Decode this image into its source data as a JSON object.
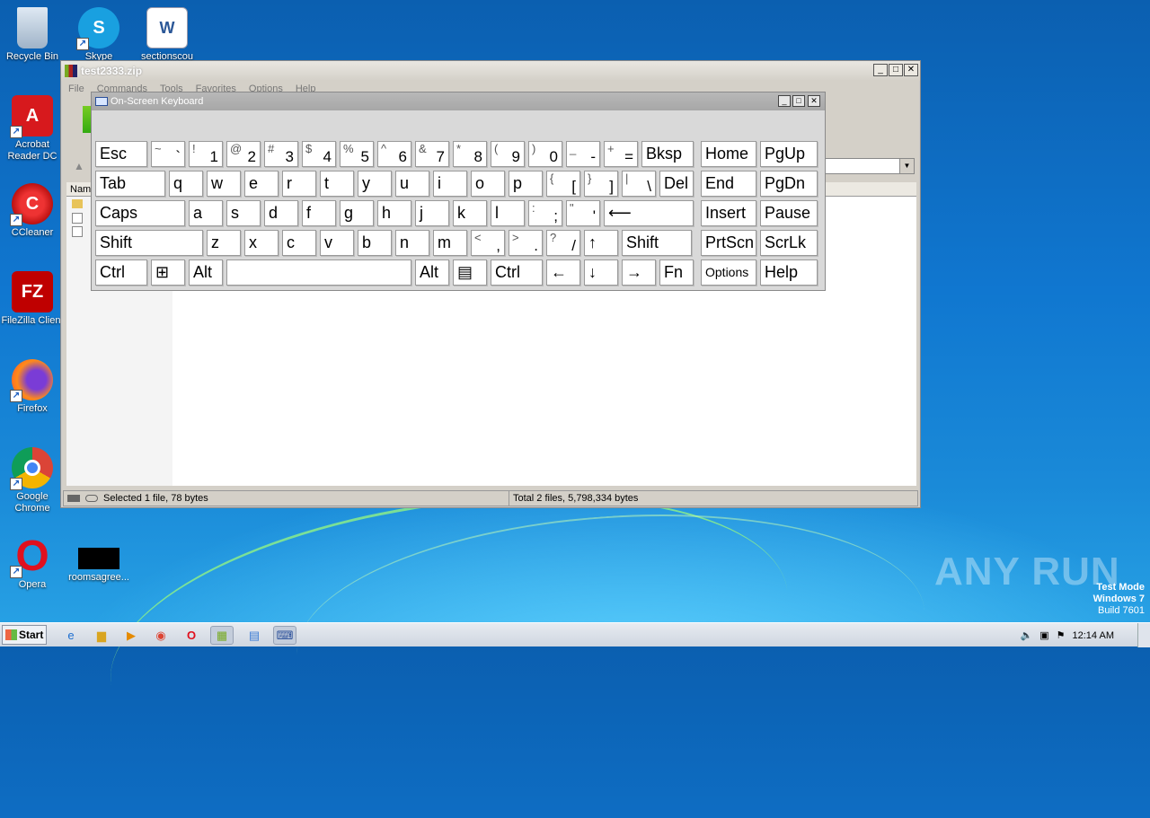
{
  "desktop": {
    "icons": [
      {
        "label": "Recycle Bin"
      },
      {
        "label": "Skype"
      },
      {
        "label": "sectionscou"
      },
      {
        "label": "Acrobat Reader DC"
      },
      {
        "label": "CCleaner"
      },
      {
        "label": "FileZilla Client"
      },
      {
        "label": "Firefox"
      },
      {
        "label": "Google Chrome"
      },
      {
        "label": "Opera"
      },
      {
        "label": "roomsagree..."
      }
    ]
  },
  "archive_window": {
    "title": "test2333.zip",
    "menu": [
      "File",
      "Commands",
      "Tools",
      "Favorites",
      "Options",
      "Help"
    ],
    "column_name": "Name",
    "status_left": "Selected 1 file, 78 bytes",
    "status_right": "Total 2 files, 5,798,334 bytes"
  },
  "osk": {
    "title": "On-Screen Keyboard",
    "rows": [
      [
        {
          "m": "Esc"
        },
        {
          "t": "~",
          "b": "`"
        },
        {
          "t": "!",
          "b": "1"
        },
        {
          "t": "@",
          "b": "2"
        },
        {
          "t": "#",
          "b": "3"
        },
        {
          "t": "$",
          "b": "4"
        },
        {
          "t": "%",
          "b": "5"
        },
        {
          "t": "^",
          "b": "6"
        },
        {
          "t": "&",
          "b": "7"
        },
        {
          "t": "*",
          "b": "8"
        },
        {
          "t": "(",
          "b": "9"
        },
        {
          "t": ")",
          "b": "0"
        },
        {
          "t": "_",
          "b": "-"
        },
        {
          "t": "+",
          "b": "="
        },
        {
          "m": "Bksp"
        },
        {
          "m": "Home"
        },
        {
          "m": "PgUp"
        }
      ],
      [
        {
          "m": "Tab"
        },
        {
          "m": "q"
        },
        {
          "m": "w"
        },
        {
          "m": "e"
        },
        {
          "m": "r"
        },
        {
          "m": "t"
        },
        {
          "m": "y"
        },
        {
          "m": "u"
        },
        {
          "m": "i"
        },
        {
          "m": "o"
        },
        {
          "m": "p"
        },
        {
          "t": "{",
          "b": "["
        },
        {
          "t": "}",
          "b": "]"
        },
        {
          "t": "|",
          "b": "\\"
        },
        {
          "m": "Del"
        },
        {
          "m": "End"
        },
        {
          "m": "PgDn"
        }
      ],
      [
        {
          "m": "Caps"
        },
        {
          "m": "a"
        },
        {
          "m": "s"
        },
        {
          "m": "d"
        },
        {
          "m": "f"
        },
        {
          "m": "g"
        },
        {
          "m": "h"
        },
        {
          "m": "j"
        },
        {
          "m": "k"
        },
        {
          "m": "l"
        },
        {
          "t": ":",
          "b": ";"
        },
        {
          "t": "\"",
          "b": "'"
        },
        {
          "m": "⟵"
        },
        {
          "m": "Insert"
        },
        {
          "m": "Pause"
        }
      ],
      [
        {
          "m": "Shift"
        },
        {
          "m": "z"
        },
        {
          "m": "x"
        },
        {
          "m": "c"
        },
        {
          "m": "v"
        },
        {
          "m": "b"
        },
        {
          "m": "n"
        },
        {
          "m": "m"
        },
        {
          "t": "<",
          "b": ","
        },
        {
          "t": ">",
          "b": "."
        },
        {
          "t": "?",
          "b": "/"
        },
        {
          "m": "↑"
        },
        {
          "m": "Shift"
        },
        {
          "m": "PrtScn"
        },
        {
          "m": "ScrLk"
        }
      ],
      [
        {
          "m": "Ctrl"
        },
        {
          "m": "⊞"
        },
        {
          "m": "Alt"
        },
        {
          "m": ""
        },
        {
          "m": "Alt"
        },
        {
          "m": "▤"
        },
        {
          "m": "Ctrl"
        },
        {
          "m": "←"
        },
        {
          "m": "↓"
        },
        {
          "m": "→"
        },
        {
          "m": "Fn"
        },
        {
          "m": "Options"
        },
        {
          "m": "Help"
        }
      ]
    ]
  },
  "taskbar": {
    "start_label": "Start",
    "clock": "12:14 AM"
  },
  "watermark": {
    "line1": "Test Mode",
    "line2": "Windows 7",
    "line3": "Build 7601",
    "brand": "ANY RUN"
  }
}
